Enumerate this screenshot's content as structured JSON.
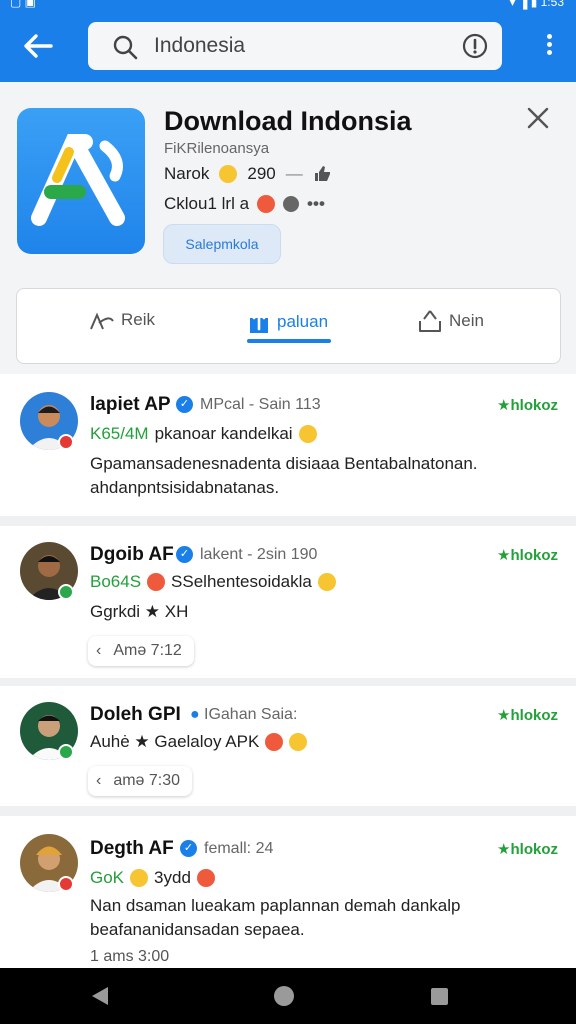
{
  "status_bar": {
    "left_text": "▢ ▣",
    "right_text": "▾ ▐ ▮ 1:53"
  },
  "search": {
    "query": "Indonesia"
  },
  "colors": {
    "primary": "#1a7fe8",
    "star_green": "#23a03a"
  },
  "icons": [
    "back-arrow-icon",
    "search-icon",
    "info-icon",
    "more-vert-icon",
    "close-icon",
    "reply-icon",
    "share-icon",
    "like-icon"
  ],
  "app": {
    "title": "Download Indonsia",
    "subtitle": "FiKRilenoansya",
    "meta1_label": "Narok",
    "meta1_value": "290",
    "meta2_label": "Cklou1 lrl a",
    "chip": "Salepmkola"
  },
  "actions": {
    "reply": "Reik",
    "share": "paluan",
    "like": "Nein"
  },
  "reviews": [
    {
      "name": "lapiet AP",
      "meta": "MPcal - Sain 113",
      "stars": "★hlokoz",
      "tag": "K65/4M",
      "line1": "pkanoar kandelkai",
      "body": "Gpamansadenesnadenta disiaaa Bentabalnatonan. ahdanpntsisidabnatanas."
    },
    {
      "name": "Dgoib AF",
      "meta": "lakent - 2sin 190",
      "stars": "★hlokoz",
      "tag": "Bo64S",
      "line1": "SSelhentesoidakla",
      "body": "Ggrkdi ★ XH",
      "time": "Amə 7:12"
    },
    {
      "name": "Doleh GPI",
      "meta": "IGahan Saia:",
      "stars": "★hlokoz",
      "line1": "Auhė ★ Gaelaloy APK",
      "time": "amə 7:30"
    },
    {
      "name": "Degth AF",
      "meta": "femall: 24",
      "stars": "★hlokoz",
      "tag": "GoK",
      "line1": "3ydd",
      "body": "Nan dsaman lueakam paplannan demah dankalp beafananidansadan sepaea.",
      "time": "1 ams 3:00"
    }
  ]
}
